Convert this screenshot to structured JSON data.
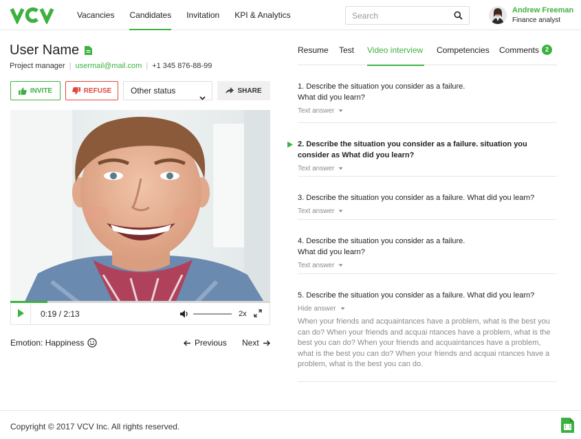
{
  "brand": {
    "logo_text": "VCV",
    "accent": "#3db140",
    "danger": "#e2453c"
  },
  "nav": {
    "items": [
      {
        "label": "Vacancies",
        "active": false
      },
      {
        "label": "Candidates",
        "active": true
      },
      {
        "label": "Invitation",
        "active": false
      },
      {
        "label": "KPI & Analytics",
        "active": false
      }
    ]
  },
  "search": {
    "placeholder": "Search",
    "icon": "search-icon"
  },
  "user": {
    "name": "Andrew Freeman",
    "role": "Finance analyst"
  },
  "candidate": {
    "name": "User Name",
    "position": "Project manager",
    "email": "usermail@mail.com",
    "phone": "+1 345 876-88-99"
  },
  "actions": {
    "invite": "INVITE",
    "refuse": "REFUSE",
    "status": "Other status",
    "share": "SHARE"
  },
  "player": {
    "time": "0:19 / 2:13",
    "progress": 0.143,
    "speed": "2x"
  },
  "emotion": {
    "label": "Emotion: Happiness",
    "icon": "smile-icon"
  },
  "pager": {
    "previous": "Previous",
    "next": "Next"
  },
  "tabs": [
    {
      "label": "Resume",
      "active": false
    },
    {
      "label": "Test",
      "active": false
    },
    {
      "label": "Video interview",
      "active": true
    },
    {
      "label": "Competencies",
      "active": false
    },
    {
      "label": "Comments",
      "active": false
    }
  ],
  "comments_count": "2",
  "questions": [
    {
      "text": "1. Describe the situation you consider as a failure. What did you learn?",
      "toggle": "Text answer",
      "active": false
    },
    {
      "text": "2. Describe the situation you consider as a failure. situation you consider as What did you learn?",
      "toggle": "Text answer",
      "active": true
    },
    {
      "text": "3. Describe the situation you consider as a failure. What did you learn?",
      "toggle": "Text answer",
      "active": false
    },
    {
      "text": "4. Describe the situation you consider as a failure. What did you learn?",
      "toggle": "Text answer",
      "active": false
    },
    {
      "text": "5. Describe the situation you consider as a failure. What did you learn?",
      "toggle": "Hide answer",
      "active": false,
      "answer": "When your friends and acquaintances have a problem, what is the best you can do? When your friends and acquai ntances have a problem, what is the best you can do? When your friends and acquaintances have a problem, what is the best you can do? When your friends and acquai ntances have a problem, what is the best you can do."
    }
  ],
  "footer": {
    "copyright": "Copyright © 2017 VCV Inc. All rights reserved."
  }
}
